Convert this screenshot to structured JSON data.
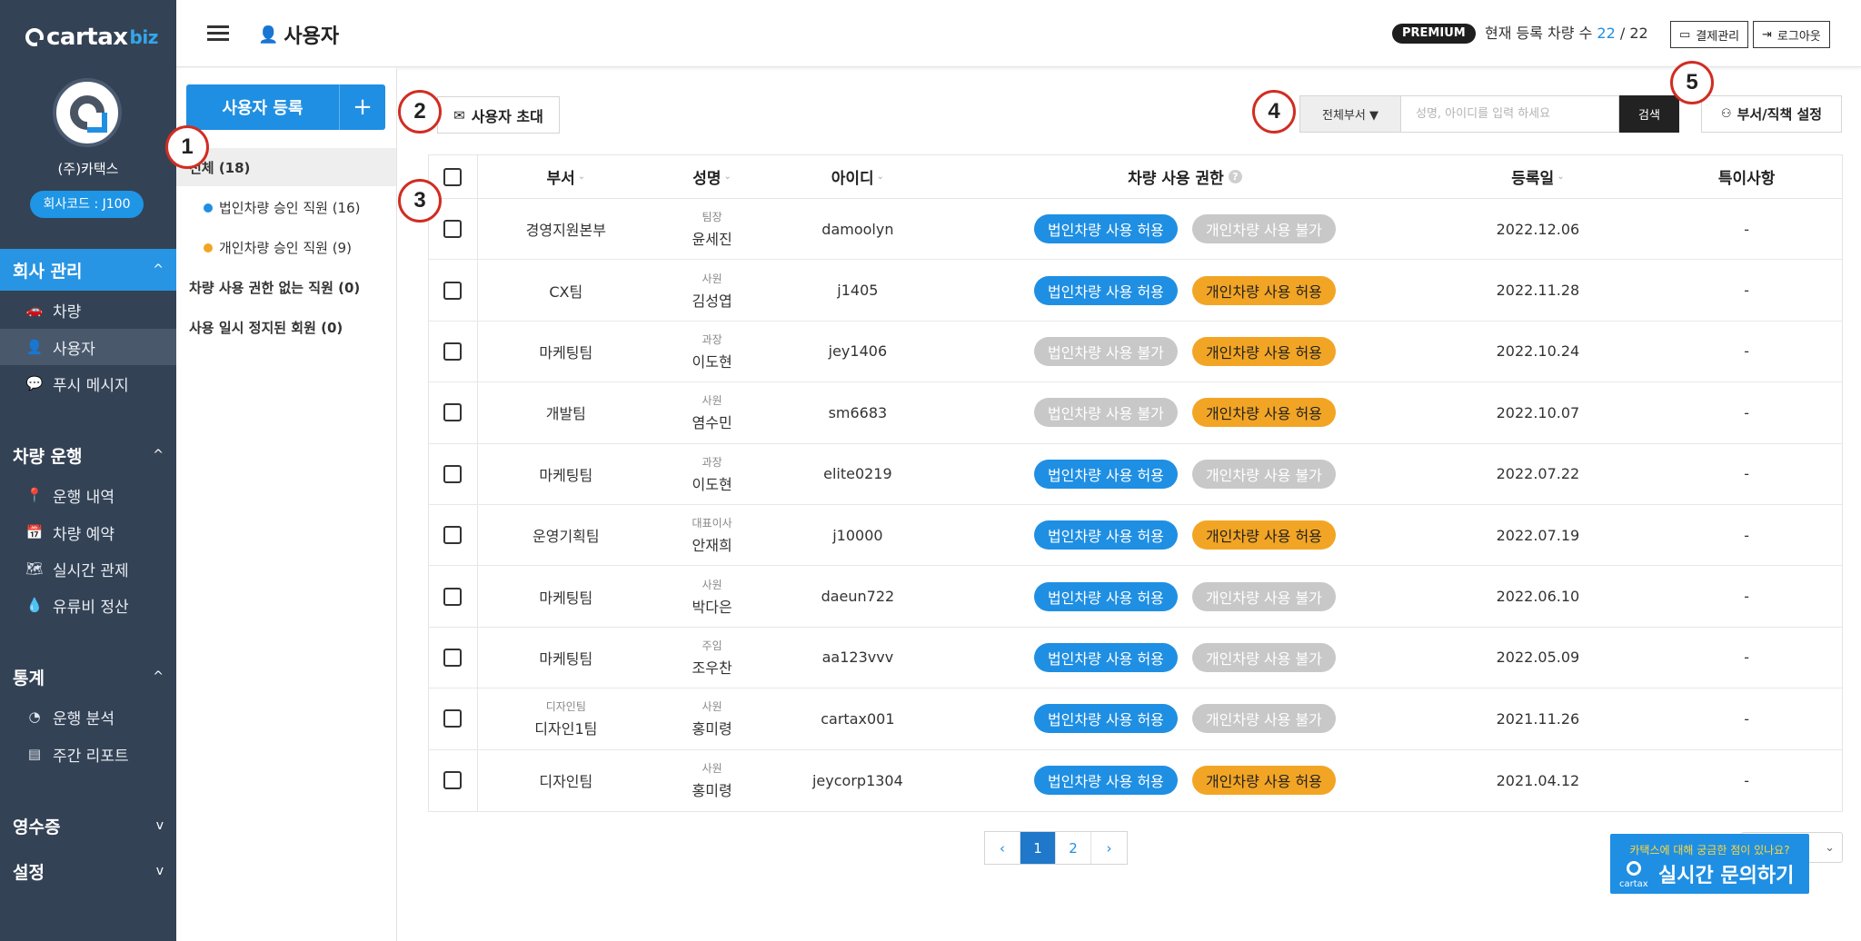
{
  "sidebar": {
    "logo_text": "cartax",
    "logo_suffix": "biz",
    "company_name": "(주)카택스",
    "company_code": "회사코드 : J100",
    "sections": [
      {
        "label": "회사 관리",
        "chevron": "^"
      },
      {
        "label": "차량 운행",
        "chevron": "^"
      },
      {
        "label": "통계",
        "chevron": "^"
      },
      {
        "label": "영수증",
        "chevron": "v"
      },
      {
        "label": "설정",
        "chevron": "v"
      }
    ],
    "items": [
      {
        "label": "차량",
        "icon": "car-icon"
      },
      {
        "label": "사용자",
        "icon": "user-add-icon"
      },
      {
        "label": "푸시 메시지",
        "icon": "chat-icon"
      },
      {
        "label": "운행 내역",
        "icon": "location-pin-icon"
      },
      {
        "label": "차량 예약",
        "icon": "calendar-icon"
      },
      {
        "label": "실시간 관제",
        "icon": "map-icon"
      },
      {
        "label": "유류비 정산",
        "icon": "fuel-drop-icon"
      },
      {
        "label": "운행 분석",
        "icon": "pie-chart-icon"
      },
      {
        "label": "주간 리포트",
        "icon": "report-icon"
      }
    ]
  },
  "header": {
    "title": "사용자",
    "premium": "PREMIUM",
    "reg_label": "현재 등록 차량 수",
    "reg_current": "22",
    "reg_total": "/ 22",
    "billing": "결제관리",
    "logout": "로그아웃"
  },
  "filters": {
    "register_button": "사용자 등록",
    "register_plus": "+",
    "all": "전체 (18)",
    "corporate": "법인차량 승인 직원 (16)",
    "personal": "개인차량 승인 직원 (9)",
    "no_permission": "차량 사용 권한 없는 직원 (0)",
    "suspended": "사용 일시 정지된 회원 (0)",
    "colors": {
      "corporate": "#1f8fe3",
      "personal": "#f2a524"
    }
  },
  "toolbar": {
    "invite": "사용자 초대",
    "dept_select": "전체부서 ▼",
    "search_placeholder": "성명, 아이디를 입력 하세요",
    "search": "검색",
    "org_settings": "부서/직책 설정"
  },
  "table": {
    "headers": {
      "dept": "부서",
      "name": "성명",
      "id": "아이디",
      "perm": "차량 사용 권한",
      "date": "등록일",
      "note": "특이사항"
    },
    "rows": [
      {
        "dept_sub": "",
        "dept": "경영지원본부",
        "title": "팀장",
        "name": "윤세진",
        "id": "damoolyn",
        "corp": "법인차량 사용 허용",
        "corp_style": "b-blue",
        "personal": "개인차량 사용 불가",
        "personal_style": "b-gray",
        "date": "2022.12.06",
        "note": "-"
      },
      {
        "dept_sub": "",
        "dept": "CX팀",
        "title": "사원",
        "name": "김성엽",
        "id": "j1405",
        "corp": "법인차량 사용 허용",
        "corp_style": "b-blue",
        "personal": "개인차량 사용 허용",
        "personal_style": "b-orange",
        "date": "2022.11.28",
        "note": "-"
      },
      {
        "dept_sub": "",
        "dept": "마케팅팀",
        "title": "과장",
        "name": "이도현",
        "id": "jey1406",
        "corp": "법인차량 사용 불가",
        "corp_style": "b-gray",
        "personal": "개인차량 사용 허용",
        "personal_style": "b-orange",
        "date": "2022.10.24",
        "note": "-"
      },
      {
        "dept_sub": "",
        "dept": "개발팀",
        "title": "사원",
        "name": "염수민",
        "id": "sm6683",
        "corp": "법인차량 사용 불가",
        "corp_style": "b-gray",
        "personal": "개인차량 사용 허용",
        "personal_style": "b-orange",
        "date": "2022.10.07",
        "note": "-"
      },
      {
        "dept_sub": "",
        "dept": "마케팅팀",
        "title": "과장",
        "name": "이도현",
        "id": "elite0219",
        "corp": "법인차량 사용 허용",
        "corp_style": "b-blue",
        "personal": "개인차량 사용 불가",
        "personal_style": "b-gray",
        "date": "2022.07.22",
        "note": "-"
      },
      {
        "dept_sub": "",
        "dept": "운영기획팀",
        "title": "대표이사",
        "name": "안재희",
        "id": "j10000",
        "corp": "법인차량 사용 허용",
        "corp_style": "b-blue",
        "personal": "개인차량 사용 허용",
        "personal_style": "b-orange",
        "date": "2022.07.19",
        "note": "-"
      },
      {
        "dept_sub": "",
        "dept": "마케팅팀",
        "title": "사원",
        "name": "박다은",
        "id": "daeun722",
        "corp": "법인차량 사용 허용",
        "corp_style": "b-blue",
        "personal": "개인차량 사용 불가",
        "personal_style": "b-gray",
        "date": "2022.06.10",
        "note": "-"
      },
      {
        "dept_sub": "",
        "dept": "마케팅팀",
        "title": "주임",
        "name": "조우찬",
        "id": "aa123vvv",
        "corp": "법인차량 사용 허용",
        "corp_style": "b-blue",
        "personal": "개인차량 사용 불가",
        "personal_style": "b-gray",
        "date": "2022.05.09",
        "note": "-"
      },
      {
        "dept_sub": "디자인팀",
        "dept": "디자인1팀",
        "title": "사원",
        "name": "홍미령",
        "id": "cartax001",
        "corp": "법인차량 사용 허용",
        "corp_style": "b-blue",
        "personal": "개인차량 사용 불가",
        "personal_style": "b-gray",
        "date": "2021.11.26",
        "note": "-"
      },
      {
        "dept_sub": "",
        "dept": "디자인팀",
        "title": "사원",
        "name": "홍미령",
        "id": "jeycorp1304",
        "corp": "법인차량 사용 허용",
        "corp_style": "b-blue",
        "personal": "개인차량 사용 허용",
        "personal_style": "b-orange",
        "date": "2021.04.12",
        "note": "-"
      }
    ]
  },
  "pagination": {
    "prev": "‹",
    "pages": [
      "1",
      "2"
    ],
    "current": "1",
    "next": "›"
  },
  "page_size_chevron": "⌄",
  "chat": {
    "question": "카택스에 대해 궁금한 점이 있나요?",
    "title": "실시간 문의하기",
    "logo": "cartax"
  },
  "markers": [
    "1",
    "2",
    "3",
    "4",
    "5"
  ]
}
